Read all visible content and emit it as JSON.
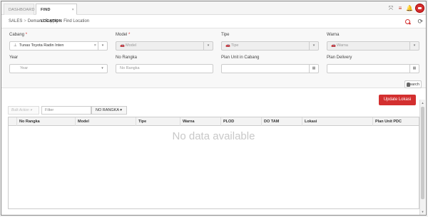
{
  "tabs": [
    {
      "label": "DASHBOARD"
    },
    {
      "label": "FIND LOCATION",
      "close": "×"
    }
  ],
  "header_icons": [
    "expand-icon",
    "menu-icon",
    "bell-icon",
    "avatar"
  ],
  "breadcrumb": [
    "SALES",
    "Demand Supply",
    "Find Location"
  ],
  "breadcrumb_sep": ">",
  "filters": {
    "cabang": {
      "label": "Cabang",
      "required": "*",
      "value": "Tunas Toyota Radin Inten",
      "clear": "×"
    },
    "model": {
      "label": "Model",
      "required": "*",
      "placeholder": "Model"
    },
    "tipe": {
      "label": "Tipe",
      "placeholder": "Tipe"
    },
    "warna": {
      "label": "Warna",
      "placeholder": "Warna"
    },
    "year": {
      "label": "Year",
      "placeholder": "Year"
    },
    "no_rangka": {
      "label": "No Rangka",
      "placeholder": "No Rangka"
    },
    "plan_unit_cabang": {
      "label": "Plan Unit in Cabang",
      "value": ""
    },
    "plan_delivery": {
      "label": "Plan Delivery",
      "value": ""
    }
  },
  "search_label": "Search",
  "update_button": "Update Lokasi",
  "toolbar": {
    "bulk_action": "Bulk Action ▾",
    "filter_placeholder": "Filter",
    "filter_by": "NO RANGKA ▾"
  },
  "table": {
    "columns": [
      "No Rangka",
      "Model",
      "Tipe",
      "Warna",
      "PLOD",
      "DO TAM",
      "Lokasi",
      "Plan Unit PDC"
    ],
    "empty_text": "No data available"
  },
  "colors": {
    "accent": "#d32f2f"
  }
}
